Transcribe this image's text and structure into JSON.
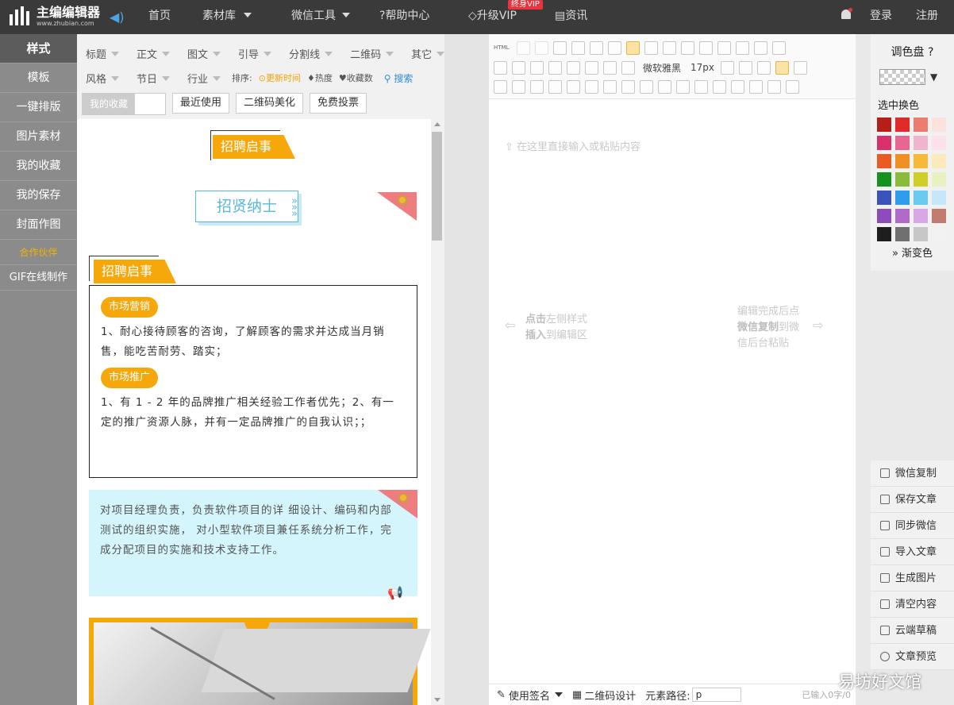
{
  "header": {
    "logo_title": "主编编辑器",
    "logo_url_text": "www.zhubian.com",
    "nav": [
      {
        "label": "首页",
        "caret": false
      },
      {
        "label": "素材库",
        "caret": true
      },
      {
        "label": "微信工具",
        "caret": true
      },
      {
        "label": "帮助中心",
        "icon": "help-icon"
      },
      {
        "label": "升级VIP",
        "icon": "diamond-icon"
      },
      {
        "label": "资讯",
        "icon": "news-icon"
      }
    ],
    "vip_badge": "终身VIP",
    "login": "登录",
    "register": "注册"
  },
  "left_nav": [
    {
      "label": "样式",
      "active": true
    },
    {
      "label": "模板"
    },
    {
      "label": "一键排版"
    },
    {
      "label": "图片素材"
    },
    {
      "label": "我的收藏"
    },
    {
      "label": "我的保存"
    },
    {
      "label": "封面作图"
    },
    {
      "label": "合作伙伴",
      "small": true
    },
    {
      "label": "GIF在线制作"
    }
  ],
  "categories": {
    "row1": [
      "标题",
      "正文",
      "图文",
      "引导",
      "分割线",
      "二维码",
      "其它"
    ],
    "row2": [
      "风格",
      "节日",
      "行业"
    ],
    "sort_label": "排序:",
    "sort_options": [
      {
        "label": "更新时间",
        "active": true
      },
      {
        "label": "热度"
      },
      {
        "label": "收藏数"
      }
    ],
    "search": "搜索"
  },
  "buttons": {
    "my_fav": "我的收藏",
    "recent": "最近使用",
    "qr_beautify": "二维码美化",
    "vote": "免费投票"
  },
  "samples": {
    "s1_title": "招聘启事",
    "s2_title": "招贤纳士",
    "s3_title": "招聘启事",
    "s3_pill1": "市场营销",
    "s3_p1": "1、耐心接待顾客的咨询，了解顾客的需求并达成当月销售，能吃苦耐劳、踏实；",
    "s3_pill2": "市场推广",
    "s3_p2": "1、有 1 - 2 年的品牌推广相关经验工作者优先；2、有一定的推广资源人脉，并有一定品牌推广的自我认识；；",
    "s4_text": "对项目经理负责，负责软件项目的详 细设计、编码和内部测试的组织实施， 对小型软件项目兼任系统分析工作，完成分配项目的实施和技术支持工作。"
  },
  "editor": {
    "html_btn": "HTML",
    "font_family": "微软雅黑",
    "font_size": "17px",
    "placeholder": "在这里直接输入或粘贴内容",
    "hint_left_1a": "点击",
    "hint_left_1b": "左侧样式",
    "hint_left_2a": "插入",
    "hint_left_2b": "到编辑区",
    "hint_right_1": "编辑完成后点",
    "hint_right_2a": "微信复制",
    "hint_right_2b": "到微",
    "hint_right_3": "信后台粘贴",
    "footer_sign": "使用签名",
    "footer_qr": "二维码设计",
    "footer_path_label": "元素路径:",
    "footer_path_value": "p",
    "word_count": "已输入0字/0"
  },
  "palette": {
    "title": "调色盘",
    "select_label": "选中换色",
    "gradient": "渐变色",
    "colors": [
      "#b51f17",
      "#e02a27",
      "#ee7b6f",
      "#fbe2dc",
      "#d9306d",
      "#e66792",
      "#f0b4cf",
      "#fbe1ec",
      "#ea5a23",
      "#f08f24",
      "#f6b93a",
      "#fbeabc",
      "#13931e",
      "#8bbb3a",
      "#d0cf2a",
      "#e8f1c2",
      "#3953b8",
      "#2f9de9",
      "#69c9f1",
      "#c4e7fa",
      "#8d4bbb",
      "#b16ac8",
      "#d8a8e6",
      "#c37b6f",
      "#1e1e1e",
      "#707070",
      "#c7c7c7",
      "#f2f2f2"
    ]
  },
  "actions": [
    {
      "label": "微信复制",
      "icon": "copy-icon"
    },
    {
      "label": "保存文章",
      "icon": "save-icon"
    },
    {
      "label": "同步微信",
      "icon": "sync-icon"
    },
    {
      "label": "导入文章",
      "icon": "import-icon"
    },
    {
      "label": "生成图片",
      "icon": "image-icon"
    },
    {
      "label": "清空内容",
      "icon": "trash-icon"
    },
    {
      "label": "云端草稿",
      "icon": "draft-icon"
    },
    {
      "label": "文章预览",
      "icon": "eye-icon"
    }
  ],
  "watermark": "易坊好文馆"
}
